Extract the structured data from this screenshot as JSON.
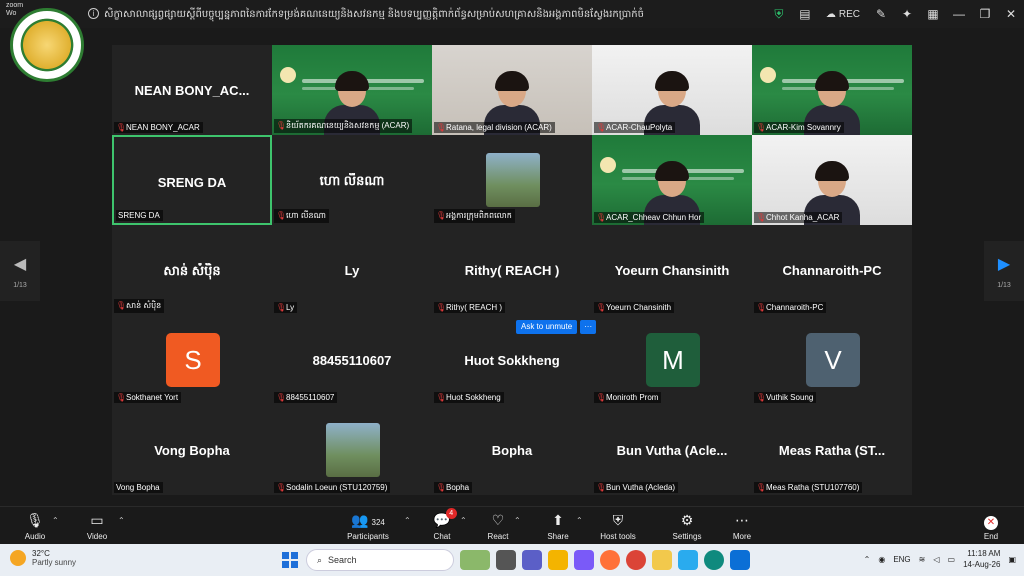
{
  "window": {
    "app_label": "zoom\nWo",
    "title": "សិក្ខាសាលាផ្សព្វផ្សាយស្ដីពីបច្ចុប្បន្នភាពនៃការកែទម្រង់គណនេយ្យនិងសវនកម្ម និងបទប្បញ្ញត្តិពាក់ព័ន្ធសម្រាប់សហគ្រាសនិងអង្គភាពមិនស្វែងរកប្រាក់ចំណេញ",
    "rec_label": "REC"
  },
  "participants": [
    {
      "name": "NEAN BONY_AC...",
      "label": "NEAN BONY_ACAR",
      "kind": "name"
    },
    {
      "name": "",
      "label": "និយ័តករគណនេយ្យនិងសវនកម្ម (ACAR)",
      "kind": "video-green"
    },
    {
      "name": "",
      "label": "Ratana, legal division (ACAR)",
      "kind": "video-room"
    },
    {
      "name": "",
      "label": "ACAR-ChauPolyta",
      "kind": "video-white"
    },
    {
      "name": "",
      "label": "ACAR-Kim Sovannry",
      "kind": "video-green"
    },
    {
      "name": "SRENG DA",
      "label": "SRENG DA",
      "kind": "name-active"
    },
    {
      "name": "ហោ លីនណា",
      "label": "ហោ លីនណា",
      "kind": "name"
    },
    {
      "name": "",
      "label": "អង្គការក្រុមពិភពលោក",
      "kind": "photo"
    },
    {
      "name": "",
      "label": "ACAR_Chheav Chhun Hor",
      "kind": "video-green"
    },
    {
      "name": "",
      "label": "Chhot Kanha_ACAR",
      "kind": "video-white"
    },
    {
      "name": "សាន់ សំប៉ិន",
      "label": "សាន់ សំប៉ិន",
      "kind": "name"
    },
    {
      "name": "Ly",
      "label": "Ly",
      "kind": "name"
    },
    {
      "name": "Rithy( REACH )",
      "label": "Rithy( REACH )",
      "kind": "name"
    },
    {
      "name": "Yoeurn Chansinith",
      "label": "Yoeurn Chansinith",
      "kind": "name"
    },
    {
      "name": "Channaroith-PC",
      "label": "Channaroith-PC",
      "kind": "name"
    },
    {
      "name": "S",
      "label": "Sokthanet Yort",
      "kind": "avatar",
      "color": "#f05a22"
    },
    {
      "name": "88455110607",
      "label": "88455110607",
      "kind": "name"
    },
    {
      "name": "Huot Sokkheng",
      "label": "Huot Sokkheng",
      "kind": "name"
    },
    {
      "name": "M",
      "label": "Moniroth Prom",
      "kind": "avatar",
      "color": "#1f5e3b"
    },
    {
      "name": "V",
      "label": "Vuthik Soung",
      "kind": "avatar",
      "color": "#4e6170"
    },
    {
      "name": "Vong Bopha",
      "label": "Vong Bopha",
      "kind": "name-nomic"
    },
    {
      "name": "",
      "label": "Sodalin Loeun (STU120759)",
      "kind": "photo"
    },
    {
      "name": "Bopha",
      "label": "Bopha",
      "kind": "name"
    },
    {
      "name": "Bun Vutha (Acle...",
      "label": "Bun Vutha (Acleda)",
      "kind": "name"
    },
    {
      "name": "Meas Ratha (ST...",
      "label": "Meas Ratha (STU107760)",
      "kind": "name"
    }
  ],
  "nav": {
    "left_page": "1/13",
    "right_page": "1/13"
  },
  "popover": {
    "unmute": "Ask to unmute",
    "more": "···"
  },
  "toolbar": {
    "audio": "Audio",
    "video": "Video",
    "participants": "Participants",
    "participant_count": "324",
    "chat": "Chat",
    "chat_badge": "4",
    "react": "React",
    "share": "Share",
    "host_tools": "Host tools",
    "settings": "Settings",
    "more": "More",
    "end": "End"
  },
  "taskbar": {
    "temp": "32°C",
    "condition": "Partly sunny",
    "search_placeholder": "Search",
    "lang": "ENG",
    "time": "11:18 AM",
    "date": "14-Aug-26"
  },
  "colors": {
    "accent": "#0e72ed",
    "active_border": "#3ec46d",
    "end": "#e02828",
    "banner_green": "#1f7a3a"
  }
}
